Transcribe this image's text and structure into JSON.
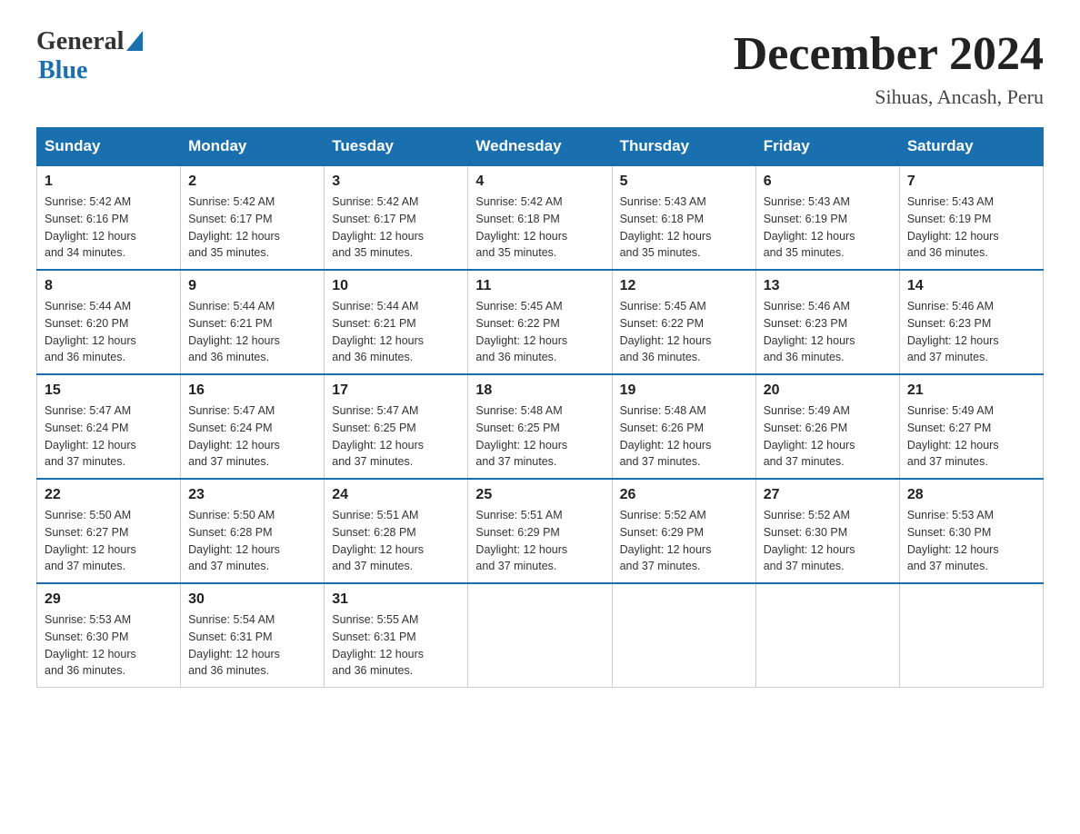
{
  "header": {
    "logo_general": "General",
    "logo_blue": "Blue",
    "title": "December 2024",
    "subtitle": "Sihuas, Ancash, Peru"
  },
  "days_of_week": [
    "Sunday",
    "Monday",
    "Tuesday",
    "Wednesday",
    "Thursday",
    "Friday",
    "Saturday"
  ],
  "weeks": [
    [
      {
        "day": "1",
        "sunrise": "5:42 AM",
        "sunset": "6:16 PM",
        "daylight": "12 hours and 34 minutes."
      },
      {
        "day": "2",
        "sunrise": "5:42 AM",
        "sunset": "6:17 PM",
        "daylight": "12 hours and 35 minutes."
      },
      {
        "day": "3",
        "sunrise": "5:42 AM",
        "sunset": "6:17 PM",
        "daylight": "12 hours and 35 minutes."
      },
      {
        "day": "4",
        "sunrise": "5:42 AM",
        "sunset": "6:18 PM",
        "daylight": "12 hours and 35 minutes."
      },
      {
        "day": "5",
        "sunrise": "5:43 AM",
        "sunset": "6:18 PM",
        "daylight": "12 hours and 35 minutes."
      },
      {
        "day": "6",
        "sunrise": "5:43 AM",
        "sunset": "6:19 PM",
        "daylight": "12 hours and 35 minutes."
      },
      {
        "day": "7",
        "sunrise": "5:43 AM",
        "sunset": "6:19 PM",
        "daylight": "12 hours and 36 minutes."
      }
    ],
    [
      {
        "day": "8",
        "sunrise": "5:44 AM",
        "sunset": "6:20 PM",
        "daylight": "12 hours and 36 minutes."
      },
      {
        "day": "9",
        "sunrise": "5:44 AM",
        "sunset": "6:21 PM",
        "daylight": "12 hours and 36 minutes."
      },
      {
        "day": "10",
        "sunrise": "5:44 AM",
        "sunset": "6:21 PM",
        "daylight": "12 hours and 36 minutes."
      },
      {
        "day": "11",
        "sunrise": "5:45 AM",
        "sunset": "6:22 PM",
        "daylight": "12 hours and 36 minutes."
      },
      {
        "day": "12",
        "sunrise": "5:45 AM",
        "sunset": "6:22 PM",
        "daylight": "12 hours and 36 minutes."
      },
      {
        "day": "13",
        "sunrise": "5:46 AM",
        "sunset": "6:23 PM",
        "daylight": "12 hours and 36 minutes."
      },
      {
        "day": "14",
        "sunrise": "5:46 AM",
        "sunset": "6:23 PM",
        "daylight": "12 hours and 37 minutes."
      }
    ],
    [
      {
        "day": "15",
        "sunrise": "5:47 AM",
        "sunset": "6:24 PM",
        "daylight": "12 hours and 37 minutes."
      },
      {
        "day": "16",
        "sunrise": "5:47 AM",
        "sunset": "6:24 PM",
        "daylight": "12 hours and 37 minutes."
      },
      {
        "day": "17",
        "sunrise": "5:47 AM",
        "sunset": "6:25 PM",
        "daylight": "12 hours and 37 minutes."
      },
      {
        "day": "18",
        "sunrise": "5:48 AM",
        "sunset": "6:25 PM",
        "daylight": "12 hours and 37 minutes."
      },
      {
        "day": "19",
        "sunrise": "5:48 AM",
        "sunset": "6:26 PM",
        "daylight": "12 hours and 37 minutes."
      },
      {
        "day": "20",
        "sunrise": "5:49 AM",
        "sunset": "6:26 PM",
        "daylight": "12 hours and 37 minutes."
      },
      {
        "day": "21",
        "sunrise": "5:49 AM",
        "sunset": "6:27 PM",
        "daylight": "12 hours and 37 minutes."
      }
    ],
    [
      {
        "day": "22",
        "sunrise": "5:50 AM",
        "sunset": "6:27 PM",
        "daylight": "12 hours and 37 minutes."
      },
      {
        "day": "23",
        "sunrise": "5:50 AM",
        "sunset": "6:28 PM",
        "daylight": "12 hours and 37 minutes."
      },
      {
        "day": "24",
        "sunrise": "5:51 AM",
        "sunset": "6:28 PM",
        "daylight": "12 hours and 37 minutes."
      },
      {
        "day": "25",
        "sunrise": "5:51 AM",
        "sunset": "6:29 PM",
        "daylight": "12 hours and 37 minutes."
      },
      {
        "day": "26",
        "sunrise": "5:52 AM",
        "sunset": "6:29 PM",
        "daylight": "12 hours and 37 minutes."
      },
      {
        "day": "27",
        "sunrise": "5:52 AM",
        "sunset": "6:30 PM",
        "daylight": "12 hours and 37 minutes."
      },
      {
        "day": "28",
        "sunrise": "5:53 AM",
        "sunset": "6:30 PM",
        "daylight": "12 hours and 37 minutes."
      }
    ],
    [
      {
        "day": "29",
        "sunrise": "5:53 AM",
        "sunset": "6:30 PM",
        "daylight": "12 hours and 36 minutes."
      },
      {
        "day": "30",
        "sunrise": "5:54 AM",
        "sunset": "6:31 PM",
        "daylight": "12 hours and 36 minutes."
      },
      {
        "day": "31",
        "sunrise": "5:55 AM",
        "sunset": "6:31 PM",
        "daylight": "12 hours and 36 minutes."
      },
      null,
      null,
      null,
      null
    ]
  ],
  "labels": {
    "sunrise": "Sunrise:",
    "sunset": "Sunset:",
    "daylight": "Daylight:"
  }
}
